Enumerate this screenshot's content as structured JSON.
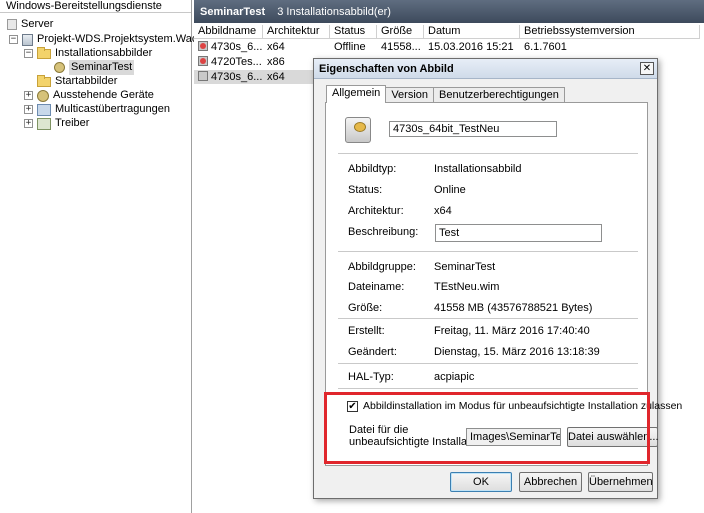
{
  "tree": {
    "header": "Windows-Bereitstellungsdienste",
    "items": [
      {
        "label": "Server"
      },
      {
        "label": "Projekt-WDS.Projektsystem.Wachter"
      },
      {
        "label": "Installationsabbilder"
      },
      {
        "label": "SeminarTest"
      },
      {
        "label": "Startabbilder"
      },
      {
        "label": "Ausstehende Geräte"
      },
      {
        "label": "Multicastübertragungen"
      },
      {
        "label": "Treiber"
      }
    ]
  },
  "list": {
    "title": "SeminarTest",
    "subtitle": "3 Installationsabbild(er)",
    "columns": [
      "Abbildname",
      "Architektur",
      "Status",
      "Größe",
      "Datum",
      "Betriebssystemversion"
    ],
    "rows": [
      [
        "4730s_6...",
        "x64",
        "Offline",
        "41558...",
        "15.03.2016 15:21",
        "6.1.7601"
      ],
      [
        "4720Tes...",
        "x86",
        "",
        "",
        "",
        ""
      ],
      [
        "4730s_6...",
        "x64",
        "",
        "",
        "",
        ""
      ]
    ]
  },
  "dialog": {
    "title": "Eigenschaften von Abbild",
    "close": "✕",
    "tabs": [
      "Allgemein",
      "Version",
      "Benutzerberechtigungen"
    ],
    "name_value": "4730s_64bit_TestNeu",
    "labels": {
      "abbildtyp": "Abbildtyp:",
      "status": "Status:",
      "architektur": "Architektur:",
      "beschreibung": "Beschreibung:",
      "abbildgruppe": "Abbildgruppe:",
      "dateiname": "Dateiname:",
      "groesse": "Größe:",
      "erstellt": "Erstellt:",
      "geaendert": "Geändert:",
      "hal": "HAL-Typ:"
    },
    "values": {
      "abbildtyp": "Installationsabbild",
      "status": "Online",
      "architektur": "x64",
      "beschreibung": "Test",
      "abbildgruppe": "SeminarTest",
      "dateiname": "TEstNeu.wim",
      "groesse": "41558 MB (43576788521 Bytes)",
      "erstellt": "Freitag, 11. März 2016 17:40:40",
      "geaendert": "Dienstag, 15. März 2016 13:18:39",
      "hal": "acpiapic"
    },
    "unattend": {
      "checkbox_label": "Abbildinstallation im Modus für unbeaufsichtigte Installation zulassen",
      "checked_mark": "✔",
      "file_label_line1": "Datei für die",
      "file_label_line2": "unbeaufsichtigte Installation:",
      "file_value": "Images\\SeminarTest\\T",
      "browse_button": "Datei auswählen..."
    },
    "buttons": {
      "ok": "OK",
      "cancel": "Abbrechen",
      "apply": "Übernehmen"
    },
    "colors": {
      "highlight_box": "#e0262c"
    }
  }
}
